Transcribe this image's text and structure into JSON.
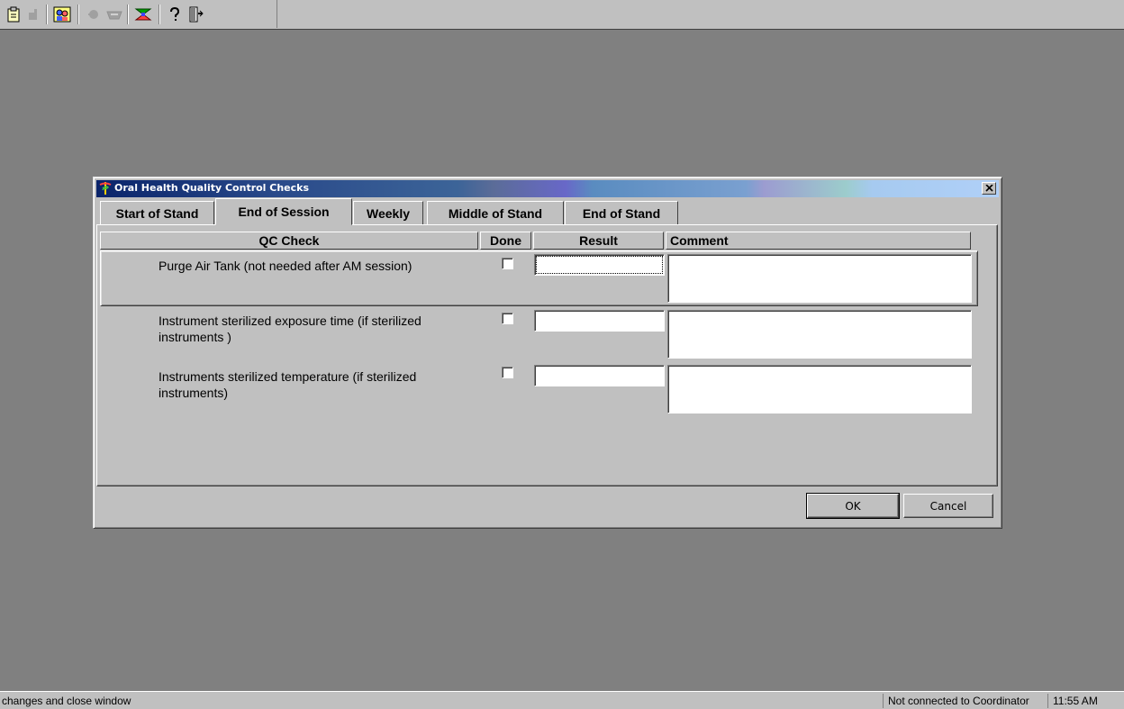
{
  "toolbar": {
    "buttons": [
      {
        "icon": "clipboard-icon",
        "enabled": true
      },
      {
        "icon": "hand-icon",
        "enabled": false
      },
      {
        "icon": "people-icon",
        "enabled": true
      },
      {
        "icon": "pointing-hand-icon",
        "enabled": false
      },
      {
        "icon": "tray-icon",
        "enabled": false
      },
      {
        "icon": "transfer-icon",
        "enabled": true
      },
      {
        "icon": "help-icon",
        "enabled": true
      },
      {
        "icon": "exit-door-icon",
        "enabled": true
      }
    ]
  },
  "dialog": {
    "title": "Oral Health Quality Control Checks",
    "close_label": "×",
    "tabs": [
      {
        "label": "Start of Stand"
      },
      {
        "label": "End of Session",
        "active": true
      },
      {
        "label": "Weekly"
      },
      {
        "label": "Middle of Stand"
      },
      {
        "label": "End of Stand"
      }
    ],
    "columns": {
      "qc_check": "QC Check",
      "done": "Done",
      "result": "Result",
      "comment": "Comment"
    },
    "rows": [
      {
        "check": "Purge Air Tank (not needed after AM session)",
        "done": false,
        "result": "",
        "comment": ""
      },
      {
        "check": "Instrument sterilized exposure time (if sterilized instruments )",
        "done": false,
        "result": "",
        "comment": ""
      },
      {
        "check": "Instruments sterilized temperature (if sterilized instruments)",
        "done": false,
        "result": "",
        "comment": ""
      }
    ],
    "ok_label": "OK",
    "cancel_label": "Cancel"
  },
  "statusbar": {
    "message": "changes and close window",
    "connection": "Not connected to Coordinator",
    "time": "11:55 AM"
  },
  "colors": {
    "desktop": "#808080",
    "face": "#c0c0c0",
    "title_start": "#0a246a",
    "title_end": "#b0d0f8"
  }
}
